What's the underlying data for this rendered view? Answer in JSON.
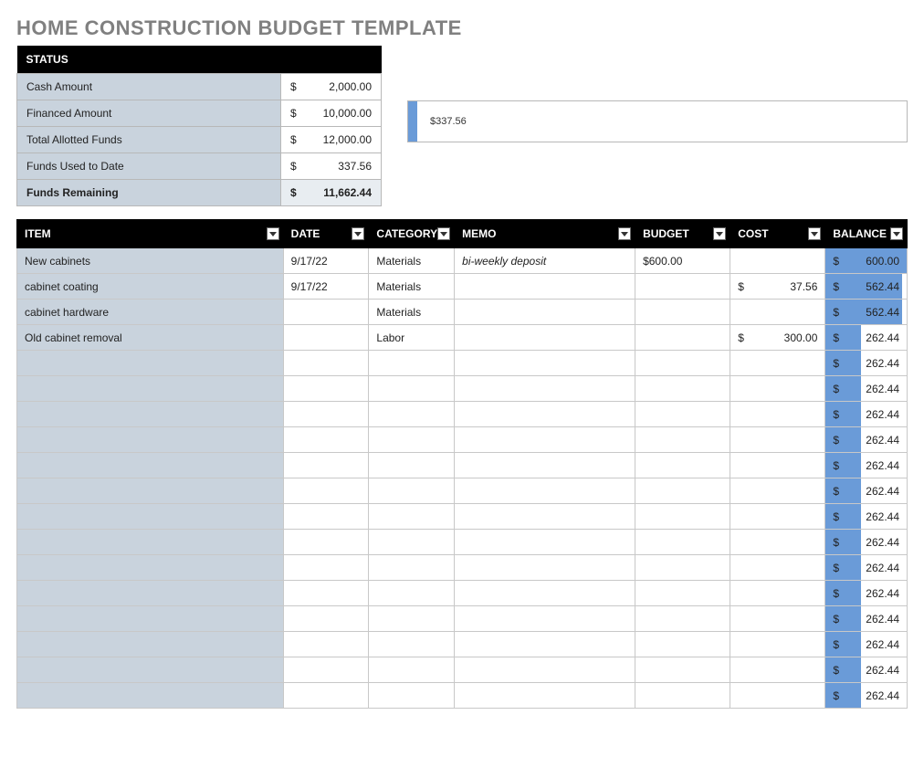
{
  "title": "HOME CONSTRUCTION BUDGET TEMPLATE",
  "status": {
    "header": "STATUS",
    "rows": [
      {
        "label": "Cash Amount",
        "value": "2,000.00",
        "bold": false
      },
      {
        "label": "Financed Amount",
        "value": "10,000.00",
        "bold": false
      },
      {
        "label": "Total Allotted Funds",
        "value": "12,000.00",
        "bold": false
      },
      {
        "label": "Funds Used to Date",
        "value": "337.56",
        "bold": false
      },
      {
        "label": "Funds Remaining",
        "value": "11,662.44",
        "bold": true
      }
    ]
  },
  "progress": {
    "label": "$337.56",
    "percent": 2.8
  },
  "columns": [
    "ITEM",
    "DATE",
    "CATEGORY",
    "MEMO",
    "BUDGET",
    "COST",
    "BALANCE"
  ],
  "items": [
    {
      "item": "New cabinets",
      "date": "9/17/22",
      "category": "Materials",
      "memo": "bi-weekly deposit",
      "budget": "$600.00",
      "cost": "",
      "balance": "600.00",
      "barPct": 100
    },
    {
      "item": "cabinet coating",
      "date": "9/17/22",
      "category": "Materials",
      "memo": "",
      "budget": "",
      "cost": "37.56",
      "balance": "562.44",
      "barPct": 94
    },
    {
      "item": "cabinet hardware",
      "date": "",
      "category": "Materials",
      "memo": "",
      "budget": "",
      "cost": "",
      "balance": "562.44",
      "barPct": 94
    },
    {
      "item": "Old cabinet removal",
      "date": "",
      "category": "Labor",
      "memo": "",
      "budget": "",
      "cost": "300.00",
      "balance": "262.44",
      "barPct": 44
    },
    {
      "item": "",
      "date": "",
      "category": "",
      "memo": "",
      "budget": "",
      "cost": "",
      "balance": "262.44",
      "barPct": 44
    },
    {
      "item": "",
      "date": "",
      "category": "",
      "memo": "",
      "budget": "",
      "cost": "",
      "balance": "262.44",
      "barPct": 44
    },
    {
      "item": "",
      "date": "",
      "category": "",
      "memo": "",
      "budget": "",
      "cost": "",
      "balance": "262.44",
      "barPct": 44
    },
    {
      "item": "",
      "date": "",
      "category": "",
      "memo": "",
      "budget": "",
      "cost": "",
      "balance": "262.44",
      "barPct": 44
    },
    {
      "item": "",
      "date": "",
      "category": "",
      "memo": "",
      "budget": "",
      "cost": "",
      "balance": "262.44",
      "barPct": 44
    },
    {
      "item": "",
      "date": "",
      "category": "",
      "memo": "",
      "budget": "",
      "cost": "",
      "balance": "262.44",
      "barPct": 44
    },
    {
      "item": "",
      "date": "",
      "category": "",
      "memo": "",
      "budget": "",
      "cost": "",
      "balance": "262.44",
      "barPct": 44
    },
    {
      "item": "",
      "date": "",
      "category": "",
      "memo": "",
      "budget": "",
      "cost": "",
      "balance": "262.44",
      "barPct": 44
    },
    {
      "item": "",
      "date": "",
      "category": "",
      "memo": "",
      "budget": "",
      "cost": "",
      "balance": "262.44",
      "barPct": 44
    },
    {
      "item": "",
      "date": "",
      "category": "",
      "memo": "",
      "budget": "",
      "cost": "",
      "balance": "262.44",
      "barPct": 44
    },
    {
      "item": "",
      "date": "",
      "category": "",
      "memo": "",
      "budget": "",
      "cost": "",
      "balance": "262.44",
      "barPct": 44
    },
    {
      "item": "",
      "date": "",
      "category": "",
      "memo": "",
      "budget": "",
      "cost": "",
      "balance": "262.44",
      "barPct": 44
    },
    {
      "item": "",
      "date": "",
      "category": "",
      "memo": "",
      "budget": "",
      "cost": "",
      "balance": "262.44",
      "barPct": 44
    },
    {
      "item": "",
      "date": "",
      "category": "",
      "memo": "",
      "budget": "",
      "cost": "",
      "balance": "262.44",
      "barPct": 44
    }
  ]
}
